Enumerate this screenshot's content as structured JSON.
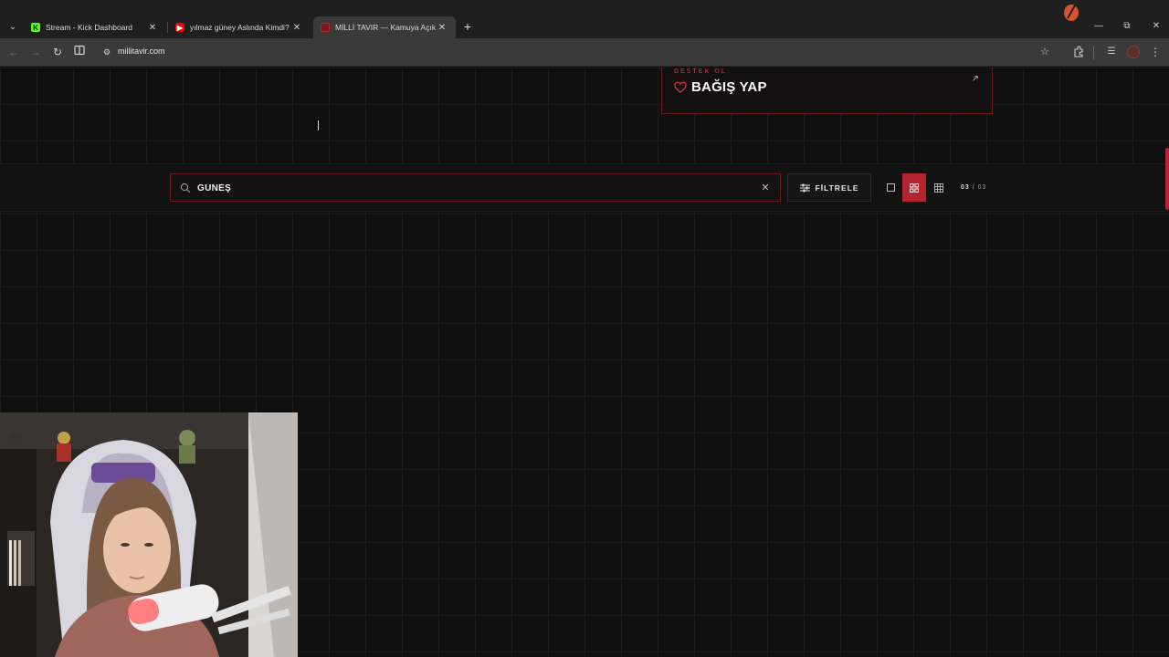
{
  "browser": {
    "tabs": [
      {
        "title": "Stream - Kick Dashboard",
        "favicon": "kick-icon",
        "active": false
      },
      {
        "title": "yılmaz güney Aslında Kimdi? | Y",
        "favicon": "youtube-icon",
        "active": false
      },
      {
        "title": "MİLLİ TAVIR — Kamuya Açık Pa",
        "favicon": "site-icon",
        "active": true
      }
    ],
    "url": "millitavir.com"
  },
  "donate": {
    "kicker": "DESTEK OL",
    "title": "BAĞIŞ YAP"
  },
  "search": {
    "value": "GÜNEŞ",
    "placeholder": ""
  },
  "filter": {
    "label": "FİLTRELE"
  },
  "results": {
    "current": "03",
    "separator": "/",
    "total": "03"
  },
  "colors": {
    "accent": "#b3242e",
    "background": "#0f0f0f"
  }
}
